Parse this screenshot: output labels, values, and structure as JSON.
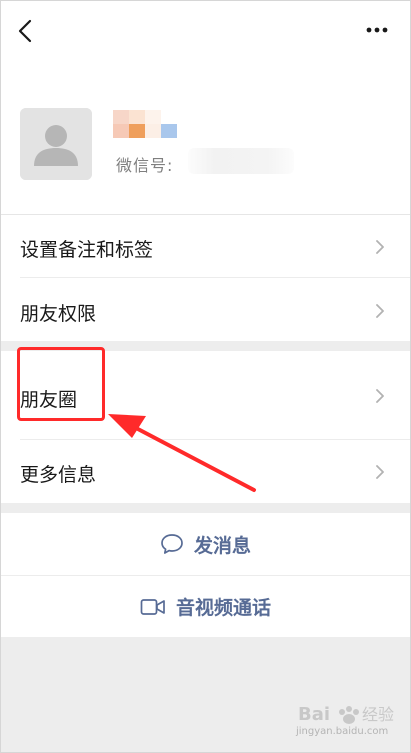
{
  "header": {
    "back_icon": "chevron-left-icon",
    "more_icon": "more-dots-icon"
  },
  "profile": {
    "avatar_icon": "default-avatar-icon",
    "wechat_id_label": "微信号:"
  },
  "menu": {
    "items": [
      {
        "label": "设置备注和标签"
      },
      {
        "label": "朋友权限"
      },
      {
        "label": "朋友圈"
      },
      {
        "label": "更多信息"
      }
    ],
    "chevron_icon": "chevron-right-icon"
  },
  "actions": {
    "message": {
      "label": "发消息",
      "icon": "chat-bubble-icon"
    },
    "call": {
      "label": "音视频通话",
      "icon": "video-camera-icon"
    }
  },
  "annotation": {
    "color": "#ff2a2a"
  },
  "colors": {
    "link": "#576b95",
    "background": "#ededed",
    "surface": "#ffffff"
  },
  "watermark": {
    "text": "jingyan.baidu.com"
  }
}
